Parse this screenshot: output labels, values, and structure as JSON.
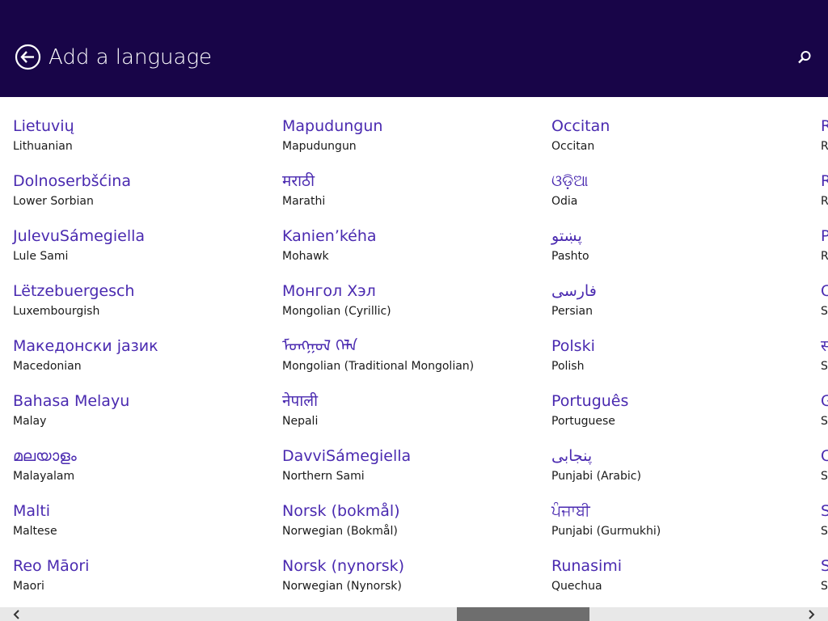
{
  "header": {
    "title": "Add a language",
    "back_icon": "back-arrow-icon",
    "search_icon": "search-icon",
    "background_color": "#180548"
  },
  "languages": {
    "columns": [
      [
        {
          "native": "Lietuvių",
          "english": "Lithuanian"
        },
        {
          "native": "Dolnoserbšćina",
          "english": "Lower Sorbian"
        },
        {
          "native": "JulevuSámegiella",
          "english": "Lule Sami"
        },
        {
          "native": "Lëtzebuergesch",
          "english": "Luxembourgish"
        },
        {
          "native": "Македонски јазик",
          "english": "Macedonian"
        },
        {
          "native": "Bahasa Melayu",
          "english": "Malay"
        },
        {
          "native": "മലയാളം",
          "english": "Malayalam"
        },
        {
          "native": "Malti",
          "english": "Maltese"
        },
        {
          "native": "Reo Māori",
          "english": "Maori"
        }
      ],
      [
        {
          "native": "Mapudungun",
          "english": "Mapudungun"
        },
        {
          "native": "मराठी",
          "english": "Marathi"
        },
        {
          "native": "Kanien’kéha",
          "english": "Mohawk"
        },
        {
          "native": "Монгол Хэл",
          "english": "Mongolian (Cyrillic)"
        },
        {
          "native": "ᠮᠣᠩᠭᠣᠯ ᠬᠡᠯᠡ",
          "english": "Mongolian (Traditional Mongolian)"
        },
        {
          "native": "नेपाली",
          "english": "Nepali"
        },
        {
          "native": "DavviSámegiella",
          "english": "Northern Sami"
        },
        {
          "native": "Norsk (bokmål)",
          "english": "Norwegian (Bokmål)"
        },
        {
          "native": "Norsk (nynorsk)",
          "english": "Norwegian (Nynorsk)"
        }
      ],
      [
        {
          "native": "Occitan",
          "english": "Occitan"
        },
        {
          "native": "ଓଡ଼ିଆ",
          "english": "Odia"
        },
        {
          "native": "پښتو",
          "english": "Pashto"
        },
        {
          "native": "فارسی",
          "english": "Persian"
        },
        {
          "native": "Polski",
          "english": "Polish"
        },
        {
          "native": "Português",
          "english": "Portuguese"
        },
        {
          "native": "پنجابی",
          "english": "Punjabi (Arabic)"
        },
        {
          "native": "ਪੰਜਾਬੀ",
          "english": "Punjabi (Gurmukhi)"
        },
        {
          "native": "Runasimi",
          "english": "Quechua"
        }
      ],
      [
        {
          "native": "R",
          "english": "R"
        },
        {
          "native": "R",
          "english": "R"
        },
        {
          "native": "P",
          "english": "R"
        },
        {
          "native": "С",
          "english": "S"
        },
        {
          "native": "स",
          "english": "S"
        },
        {
          "native": "G",
          "english": "S"
        },
        {
          "native": "С",
          "english": "S"
        },
        {
          "native": "S",
          "english": "S"
        },
        {
          "native": "S",
          "english": "S"
        }
      ]
    ]
  },
  "scrollbar": {
    "left_icon": "chevron-left-icon",
    "right_icon": "chevron-right-icon"
  },
  "colors": {
    "header": "#180548",
    "native_text": "#4a2ab0",
    "english_text": "#1a1a1a",
    "scroll_thumb": "#6e6e6e"
  }
}
